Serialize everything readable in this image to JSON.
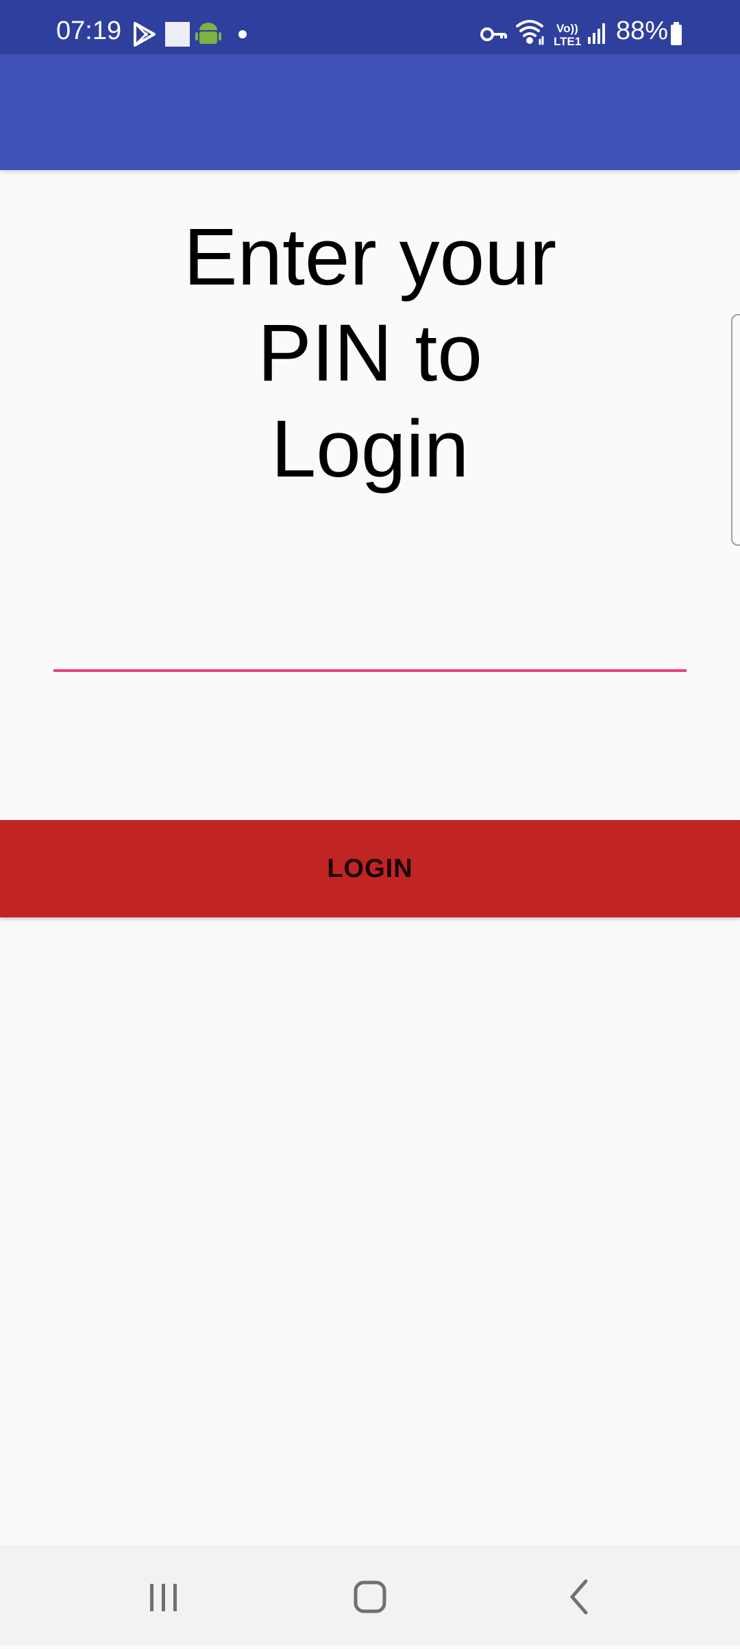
{
  "status_bar": {
    "time": "07:19",
    "battery": "88%",
    "icons": [
      "play-store-icon",
      "square-notification-icon",
      "android-icon",
      "dot-icon",
      "vpn-key-icon",
      "wifi-icon",
      "volte-lte-icon",
      "signal-icon",
      "battery-icon"
    ],
    "network_label_top": "Vo))",
    "network_label_bottom": "LTE1"
  },
  "main": {
    "title": "Enter your\nPIN to\nLogin",
    "pin_value": "",
    "login_label": "LOGIN"
  },
  "nav_bar": {
    "icons": [
      "recent-apps-icon",
      "home-icon",
      "back-icon"
    ]
  },
  "colors": {
    "status_bar": "#2f3f9e",
    "app_bar": "#3f51b5",
    "input_underline": "#ec407a",
    "login_button": "#c02523",
    "background": "#fafafa"
  }
}
